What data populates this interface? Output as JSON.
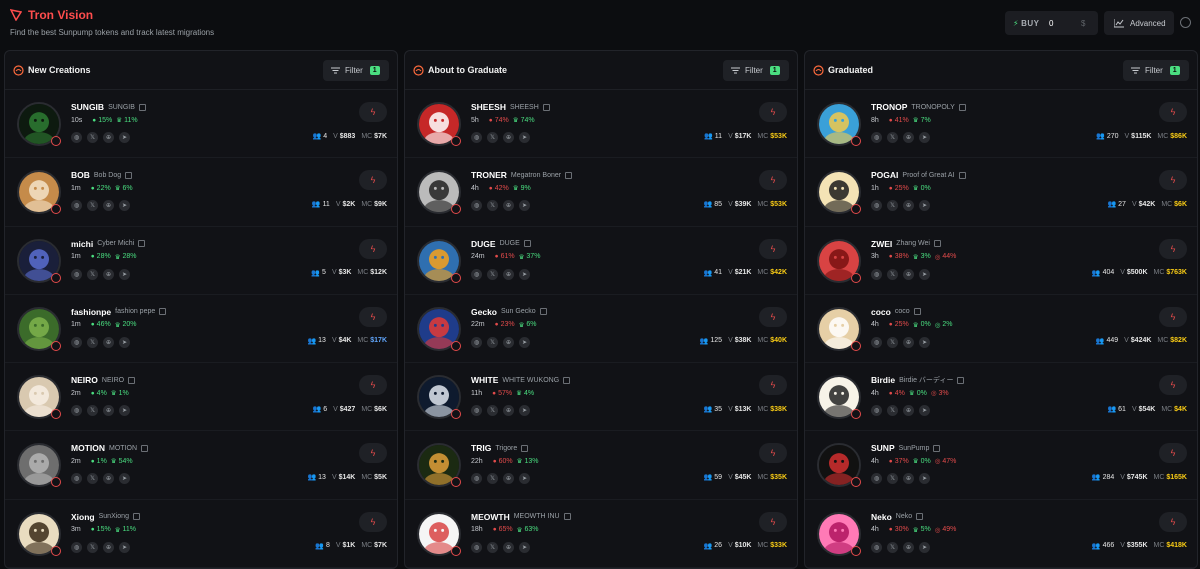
{
  "app": {
    "title": "Tron Vision",
    "tagline": "Find the best Sunpump tokens and track latest migrations"
  },
  "buy": {
    "label": "BUY",
    "value": "0",
    "unit": "$"
  },
  "advanced_label": "Advanced",
  "filter_label": "Filter",
  "colors": {
    "accent": "#ff4d4d",
    "green": "#4ade80",
    "red": "#e34b4b",
    "gold": "#facc15",
    "blue": "#60a5fa"
  },
  "columns": [
    {
      "title": "New Creations",
      "filter_count": "1",
      "icon": "leaf-icon",
      "rows": [
        {
          "ticker": "SUNGIB",
          "name": "SUNGIB",
          "age": "10s",
          "s1": "15%",
          "s2": "11%",
          "holders": "4",
          "v": "$883",
          "mc": "$7K"
        },
        {
          "ticker": "BOB",
          "name": "Bob Dog",
          "age": "1m",
          "s1": "22%",
          "s2": "6%",
          "holders": "11",
          "v": "$2K",
          "mc": "$9K"
        },
        {
          "ticker": "michi",
          "name": "Cyber Michi",
          "age": "1m",
          "s1": "28%",
          "s2": "28%",
          "holders": "5",
          "v": "$3K",
          "mc": "$12K"
        },
        {
          "ticker": "fashionpe",
          "name": "fashion pepe",
          "age": "1m",
          "s1": "46%",
          "s2": "20%",
          "holders": "13",
          "v": "$4K",
          "mc": "$17K"
        },
        {
          "ticker": "NEIRO",
          "name": "NEIRO",
          "age": "2m",
          "s1": "4%",
          "s2": "1%",
          "holders": "6",
          "v": "$427",
          "mc": "$6K"
        },
        {
          "ticker": "MOTION",
          "name": "MOTION",
          "age": "2m",
          "s1": "1%",
          "s2": "54%",
          "holders": "13",
          "v": "$14K",
          "mc": "$5K"
        },
        {
          "ticker": "Xiong",
          "name": "SunXiong",
          "age": "3m",
          "s1": "15%",
          "s2": "11%",
          "holders": "8",
          "v": "$1K",
          "mc": "$7K"
        }
      ]
    },
    {
      "title": "About to Graduate",
      "filter_count": "1",
      "icon": "graduation-cap-icon",
      "rows": [
        {
          "ticker": "SHEESH",
          "name": "SHEESH",
          "age": "5h",
          "s1": "74%",
          "s2": "74%",
          "holders": "11",
          "v": "$17K",
          "mc": "$53K"
        },
        {
          "ticker": "TRONER",
          "name": "Megatron Boner",
          "age": "4h",
          "s1": "42%",
          "s2": "9%",
          "holders": "85",
          "v": "$39K",
          "mc": "$53K"
        },
        {
          "ticker": "DUGE",
          "name": "DUGE",
          "age": "24m",
          "s1": "61%",
          "s2": "37%",
          "holders": "41",
          "v": "$21K",
          "mc": "$42K"
        },
        {
          "ticker": "Gecko",
          "name": "Sun Gecko",
          "age": "22m",
          "s1": "23%",
          "s2": "6%",
          "holders": "125",
          "v": "$38K",
          "mc": "$40K"
        },
        {
          "ticker": "WHITE",
          "name": "WHITE WUKONG",
          "age": "11h",
          "s1": "57%",
          "s2": "4%",
          "holders": "35",
          "v": "$13K",
          "mc": "$38K"
        },
        {
          "ticker": "TRIG",
          "name": "Trigore",
          "age": "22h",
          "s1": "60%",
          "s2": "13%",
          "holders": "59",
          "v": "$45K",
          "mc": "$35K"
        },
        {
          "ticker": "MEOWTH",
          "name": "MEOWTH INU",
          "age": "18h",
          "s1": "65%",
          "s2": "63%",
          "holders": "26",
          "v": "$10K",
          "mc": "$33K"
        }
      ]
    },
    {
      "title": "Graduated",
      "filter_count": "1",
      "icon": "graduated-icon",
      "rows": [
        {
          "ticker": "TRONOP",
          "name": "TRONOPOLY",
          "age": "8h",
          "s1": "41%",
          "s2": "7%",
          "holders": "270",
          "v": "$115K",
          "mc": "$86K"
        },
        {
          "ticker": "POGAI",
          "name": "Proof of Great AI",
          "age": "1h",
          "s1": "25%",
          "s2": "0%",
          "holders": "27",
          "v": "$42K",
          "mc": "$6K"
        },
        {
          "ticker": "ZWEI",
          "name": "Zhang Wei",
          "age": "3h",
          "s1": "38%",
          "s2": "3%",
          "s3": "44%",
          "holders": "404",
          "v": "$500K",
          "mc": "$763K"
        },
        {
          "ticker": "coco",
          "name": "coco",
          "age": "4h",
          "s1": "25%",
          "s2": "0%",
          "s3": "2%",
          "holders": "449",
          "v": "$424K",
          "mc": "$82K"
        },
        {
          "ticker": "Birdie",
          "name": "Birdie バーディー",
          "age": "4h",
          "s1": "4%",
          "s2": "0%",
          "s3": "3%",
          "holders": "61",
          "v": "$54K",
          "mc": "$4K"
        },
        {
          "ticker": "SUNP",
          "name": "SunPump",
          "age": "4h",
          "s1": "37%",
          "s2": "0%",
          "s3": "47%",
          "holders": "284",
          "v": "$745K",
          "mc": "$165K"
        },
        {
          "ticker": "Neko",
          "name": "Neko",
          "age": "4h",
          "s1": "30%",
          "s2": "5%",
          "s3": "49%",
          "holders": "466",
          "v": "$355K",
          "mc": "$418K"
        }
      ]
    }
  ]
}
